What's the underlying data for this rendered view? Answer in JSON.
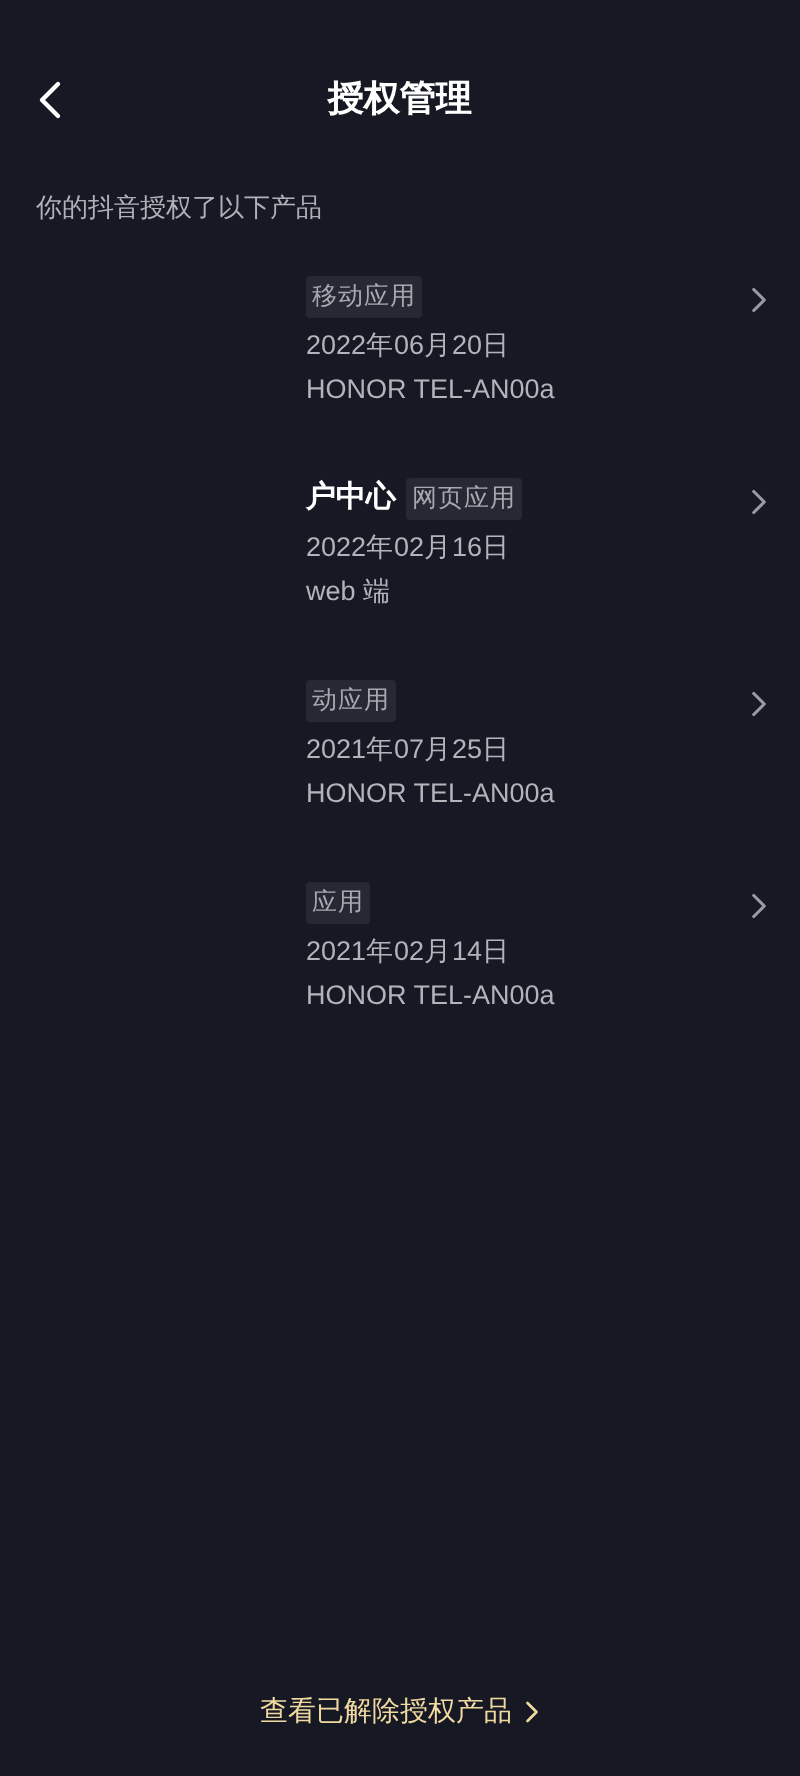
{
  "header": {
    "title": "授权管理"
  },
  "subtitle": "你的抖音授权了以下产品",
  "products": [
    {
      "tag": "移动应用",
      "date": "2022年06月20日",
      "device": "HONOR TEL-AN00a"
    },
    {
      "name": "户中心",
      "tag": "网页应用",
      "date": "2022年02月16日",
      "device": "web 端"
    },
    {
      "tag": "动应用",
      "date": "2021年07月25日",
      "device": "HONOR TEL-AN00a"
    },
    {
      "tag": "应用",
      "date": "2021年02月14日",
      "device": "HONOR TEL-AN00a"
    }
  ],
  "footer_link": "查看已解除授权产品"
}
